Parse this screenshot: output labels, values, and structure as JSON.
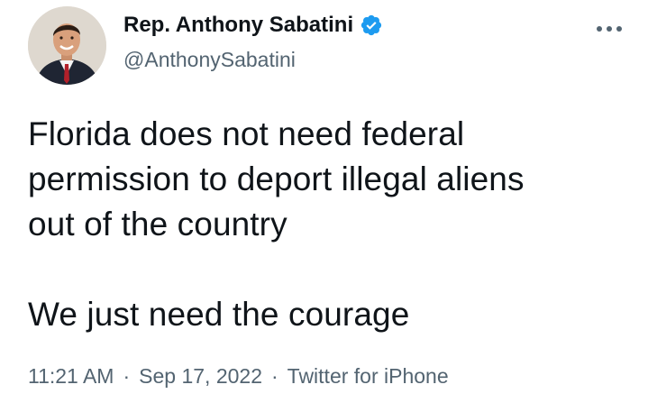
{
  "author": {
    "display_name": "Rep. Anthony Sabatini",
    "handle": "@AnthonySabatini",
    "verified": true,
    "verified_color": "#1d9bf0"
  },
  "tweet": {
    "lines_para1": [
      "Florida does not need federal",
      "permission to deport illegal aliens",
      "out of the country"
    ],
    "para2": "We just need the courage",
    "time": "11:21 AM",
    "separator": "·",
    "date": "Sep 17, 2022",
    "source": "Twitter for iPhone"
  },
  "colors": {
    "text_primary": "#0f1419",
    "text_secondary": "#536471",
    "background": "#ffffff"
  },
  "icons": {
    "avatar": "profile-photo",
    "verified": "verified-badge-icon",
    "more": "more-options-icon"
  }
}
